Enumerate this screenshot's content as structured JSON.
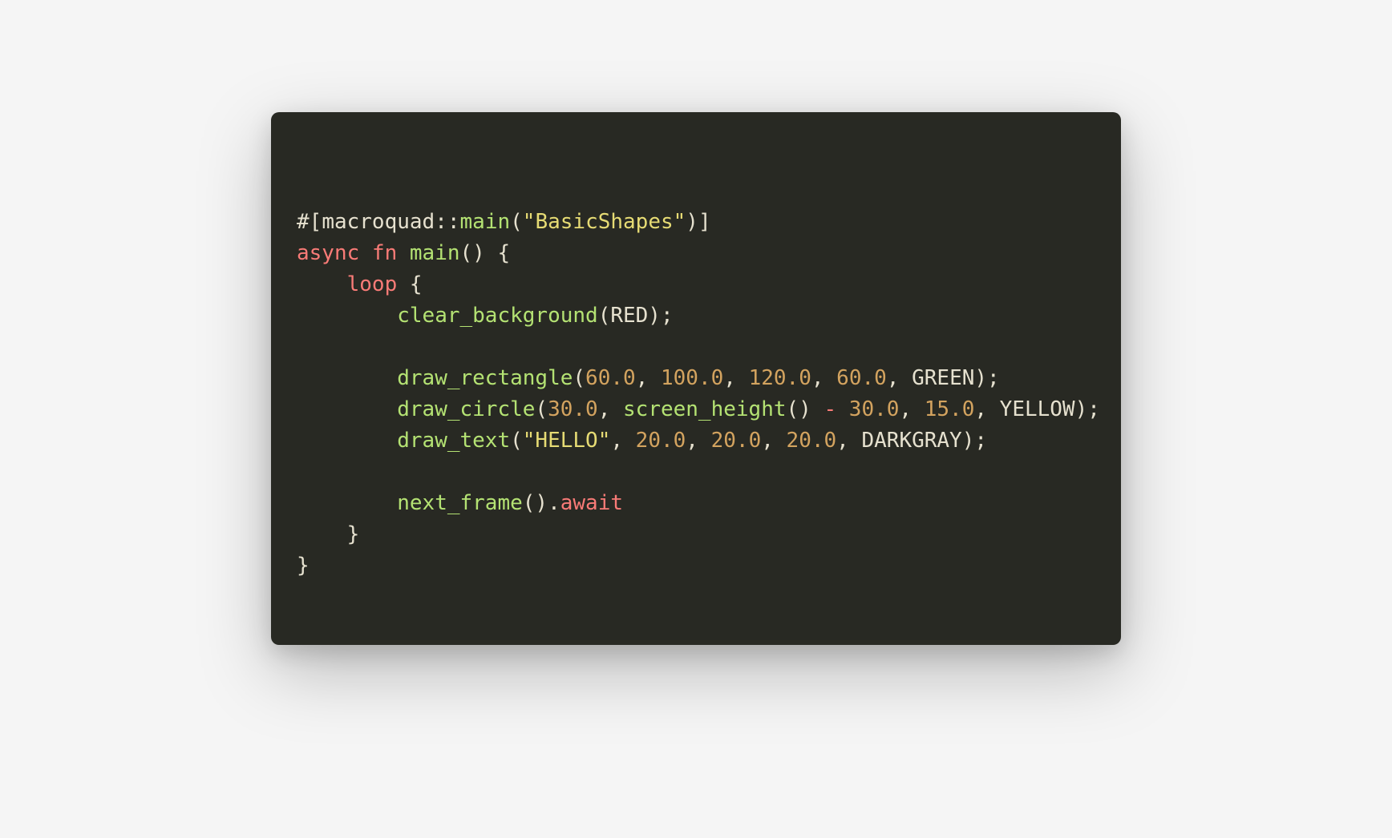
{
  "code": {
    "tokens": [
      [
        {
          "t": "#[",
          "c": "plain"
        },
        {
          "t": "macroquad",
          "c": "plain"
        },
        {
          "t": "::",
          "c": "plain"
        },
        {
          "t": "main",
          "c": "fn"
        },
        {
          "t": "(",
          "c": "plain"
        },
        {
          "t": "\"BasicShapes\"",
          "c": "str"
        },
        {
          "t": ")]",
          "c": "plain"
        }
      ],
      [
        {
          "t": "async",
          "c": "kw"
        },
        {
          "t": " ",
          "c": "plain"
        },
        {
          "t": "fn",
          "c": "kw"
        },
        {
          "t": " ",
          "c": "plain"
        },
        {
          "t": "main",
          "c": "fn"
        },
        {
          "t": "() {",
          "c": "plain"
        }
      ],
      [
        {
          "t": "    ",
          "c": "plain"
        },
        {
          "t": "loop",
          "c": "kw"
        },
        {
          "t": " {",
          "c": "plain"
        }
      ],
      [
        {
          "t": "        ",
          "c": "plain"
        },
        {
          "t": "clear_background",
          "c": "fn"
        },
        {
          "t": "(RED);",
          "c": "plain"
        }
      ],
      [
        {
          "t": "",
          "c": "plain"
        }
      ],
      [
        {
          "t": "        ",
          "c": "plain"
        },
        {
          "t": "draw_rectangle",
          "c": "fn"
        },
        {
          "t": "(",
          "c": "plain"
        },
        {
          "t": "60.0",
          "c": "num"
        },
        {
          "t": ", ",
          "c": "plain"
        },
        {
          "t": "100.0",
          "c": "num"
        },
        {
          "t": ", ",
          "c": "plain"
        },
        {
          "t": "120.0",
          "c": "num"
        },
        {
          "t": ", ",
          "c": "plain"
        },
        {
          "t": "60.0",
          "c": "num"
        },
        {
          "t": ", GREEN);",
          "c": "plain"
        }
      ],
      [
        {
          "t": "        ",
          "c": "plain"
        },
        {
          "t": "draw_circle",
          "c": "fn"
        },
        {
          "t": "(",
          "c": "plain"
        },
        {
          "t": "30.0",
          "c": "num"
        },
        {
          "t": ", ",
          "c": "plain"
        },
        {
          "t": "screen_height",
          "c": "fn"
        },
        {
          "t": "() ",
          "c": "plain"
        },
        {
          "t": "-",
          "c": "op"
        },
        {
          "t": " ",
          "c": "plain"
        },
        {
          "t": "30.0",
          "c": "num"
        },
        {
          "t": ", ",
          "c": "plain"
        },
        {
          "t": "15.0",
          "c": "num"
        },
        {
          "t": ", YELLOW);",
          "c": "plain"
        }
      ],
      [
        {
          "t": "        ",
          "c": "plain"
        },
        {
          "t": "draw_text",
          "c": "fn"
        },
        {
          "t": "(",
          "c": "plain"
        },
        {
          "t": "\"HELLO\"",
          "c": "str"
        },
        {
          "t": ", ",
          "c": "plain"
        },
        {
          "t": "20.0",
          "c": "num"
        },
        {
          "t": ", ",
          "c": "plain"
        },
        {
          "t": "20.0",
          "c": "num"
        },
        {
          "t": ", ",
          "c": "plain"
        },
        {
          "t": "20.0",
          "c": "num"
        },
        {
          "t": ", DARKGRAY);",
          "c": "plain"
        }
      ],
      [
        {
          "t": "",
          "c": "plain"
        }
      ],
      [
        {
          "t": "        ",
          "c": "plain"
        },
        {
          "t": "next_frame",
          "c": "fn"
        },
        {
          "t": "().",
          "c": "plain"
        },
        {
          "t": "await",
          "c": "kw"
        }
      ],
      [
        {
          "t": "    }",
          "c": "plain"
        }
      ],
      [
        {
          "t": "}",
          "c": "plain"
        }
      ]
    ]
  }
}
